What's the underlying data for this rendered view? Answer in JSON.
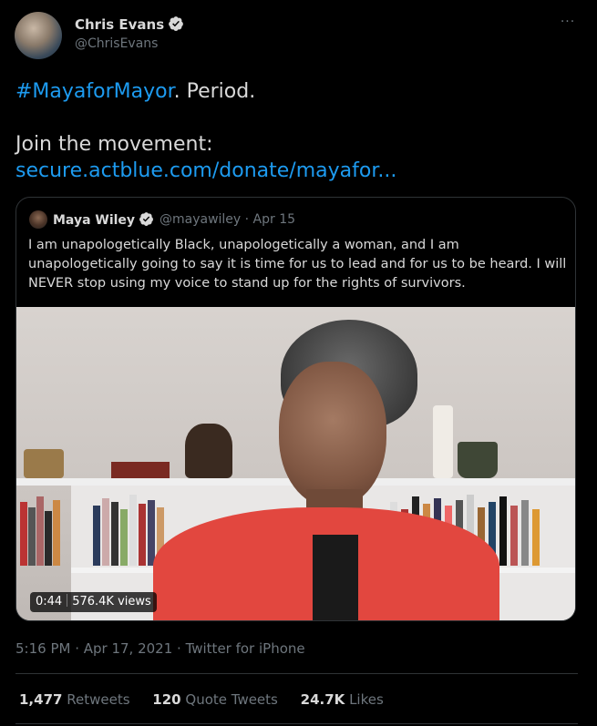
{
  "author": {
    "name": "Chris Evans",
    "handle": "@ChrisEvans",
    "verified_icon": "verified-badge-icon"
  },
  "more_label": "···",
  "tweet": {
    "hashtag": "#MayaforMayor",
    "line1_rest": ". Period.",
    "line2": "Join the movement:",
    "link": "secure.actblue.com/donate/mayafor..."
  },
  "quote": {
    "name": "Maya Wiley",
    "handle_date": "@mayawiley · Apr 15",
    "text": "I am unapologetically Black, unapologetically a woman, and I am unapologetically going to say it is time for us to lead and for us to be heard. I will NEVER stop using my voice to stand up for the rights of survivors.",
    "video": {
      "duration": "0:44",
      "views": "576.4K views"
    }
  },
  "meta": "5:16 PM · Apr 17, 2021 · Twitter for iPhone",
  "stats": {
    "retweets_count": "1,477",
    "retweets_label": "Retweets",
    "quotes_count": "120",
    "quotes_label": "Quote Tweets",
    "likes_count": "24.7K",
    "likes_label": "Likes"
  },
  "colors": {
    "background": "#000000",
    "text": "#d9d9d9",
    "muted": "#6e767d",
    "link": "#1d9bf0",
    "border": "#2f3336"
  }
}
